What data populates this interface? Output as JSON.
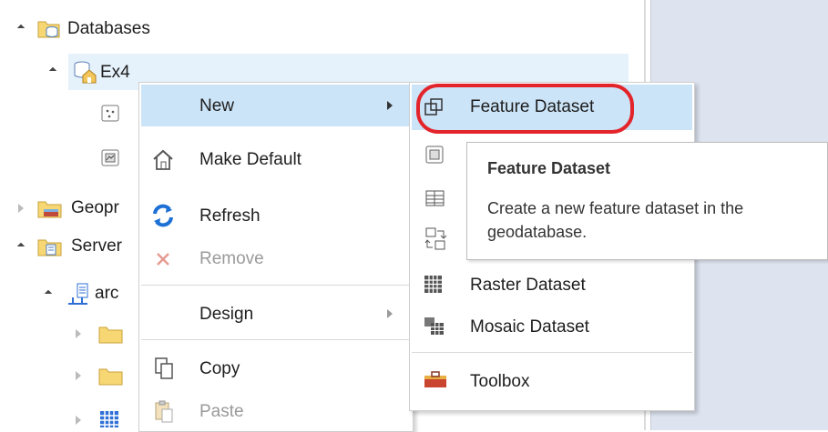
{
  "tree": {
    "databases_label": "Databases",
    "gdb_label": "Ex4",
    "geopr_label": "Geopr",
    "servers_label": "Server",
    "arc_label": "arc"
  },
  "context_menu": {
    "new_label": "New",
    "make_default_label": "Make Default",
    "refresh_label": "Refresh",
    "remove_label": "Remove",
    "design_label": "Design",
    "copy_label": "Copy",
    "paste_label": "Paste"
  },
  "submenu": {
    "feature_dataset_label": "Feature Dataset",
    "raster_dataset_label": "Raster Dataset",
    "mosaic_dataset_label": "Mosaic Dataset",
    "toolbox_label": "Toolbox"
  },
  "tooltip": {
    "title": "Feature Dataset",
    "line1": "Create a new feature dataset in the",
    "line2": "geodatabase."
  },
  "colors": {
    "menu_highlight": "#cce4f7",
    "selection_row": "#e5f1fb",
    "highlight_ellipse": "#e3242b",
    "right_panel": "#dde3ef"
  }
}
